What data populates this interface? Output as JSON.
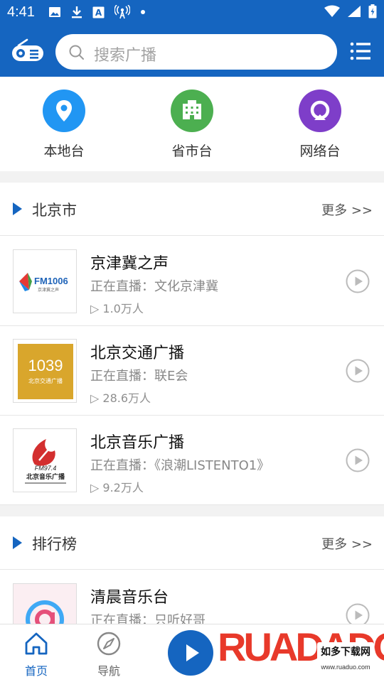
{
  "status_bar": {
    "time": "4:41"
  },
  "search": {
    "placeholder": "搜索广播"
  },
  "categories": [
    {
      "label": "本地台",
      "color": "#2196f3",
      "icon": "location-pin-icon"
    },
    {
      "label": "省市台",
      "color": "#4caf50",
      "icon": "building-icon"
    },
    {
      "label": "网络台",
      "color": "#7e3ec9",
      "icon": "network-icon"
    }
  ],
  "sections": [
    {
      "title": "北京市",
      "more": "更多 >>",
      "stations": [
        {
          "name": "京津冀之声",
          "live": "正在直播：文化京津冀",
          "listeners": "▷ 1.0万人",
          "logo_text": "FM1006",
          "logo_sub": "京津冀之声"
        },
        {
          "name": "北京交通广播",
          "live": "正在直播：联E会",
          "listeners": "▷ 28.6万人",
          "logo_text": "1039",
          "logo_sub": "北京交通广播"
        },
        {
          "name": "北京音乐广播",
          "live": "正在直播：《浪潮LISTENTO1》",
          "listeners": "▷ 9.2万人",
          "logo_text": "FM97.4",
          "logo_sub": "北京音乐广播"
        }
      ]
    },
    {
      "title": "排行榜",
      "more": "更多 >>",
      "stations": [
        {
          "name": "清晨音乐台",
          "live": "正在直播：只听好哥",
          "listeners": ""
        }
      ]
    }
  ],
  "bottom_nav": [
    {
      "label": "首页",
      "icon": "home-icon",
      "active": true
    },
    {
      "label": "导航",
      "icon": "compass-icon",
      "active": false
    }
  ],
  "watermark": {
    "brand": "RUADADO",
    "cn": "如多下载网",
    "url": "www.ruaduo.com"
  },
  "colors": {
    "primary": "#1565c0",
    "bg": "#f2f2f2"
  }
}
